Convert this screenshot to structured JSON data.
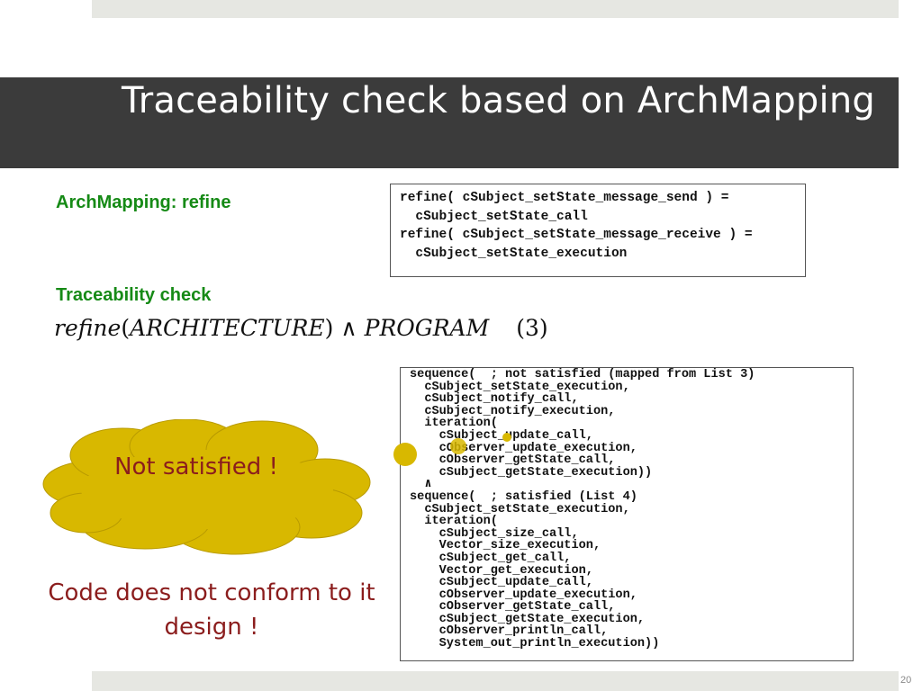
{
  "slide": {
    "title": "Traceability check based on ArchMapping",
    "number": "20"
  },
  "archmapping": {
    "heading": "ArchMapping: refine",
    "code": "refine( cSubject_setState_message_send ) =\n  cSubject_setState_call\nrefine( cSubject_setState_message_receive ) =\n  cSubject_setState_execution"
  },
  "traceability": {
    "heading": "Traceability check",
    "formula": {
      "refine": "refine",
      "open": "(",
      "architecture": "ARCHITECTURE",
      "close": ")",
      "and": " ∧ ",
      "program": "PROGRAM",
      "number": "(3)"
    }
  },
  "sequence_code": "sequence(  ; not satisfied (mapped from List 3)\n  cSubject_setState_execution,\n  cSubject_notify_call,\n  cSubject_notify_execution,\n  iteration(\n    cSubject_update_call,\n    cObserver_update_execution,\n    cObserver_getState_call,\n    cSubject_getState_execution))\n  ∧\nsequence(  ; satisfied (List 4)\n  cSubject_setState_execution,\n  iteration(\n    cSubject_size_call,\n    Vector_size_execution,\n    cSubject_get_call,\n    Vector_get_execution,\n    cSubject_update_call,\n    cObserver_update_execution,\n    cObserver_getState_call,\n    cSubject_getState_execution,\n    cObserver_println_call,\n    System_out_println_execution))",
  "callout": {
    "text": "Not satisfied !"
  },
  "note": {
    "text": "Code does not conform to it design !"
  },
  "colors": {
    "title_band": "#3b3b3b",
    "heading_green": "#168a16",
    "callout_fill": "#d8b800",
    "callout_text": "#8b1d1d",
    "bar": "#e6e7e2"
  }
}
